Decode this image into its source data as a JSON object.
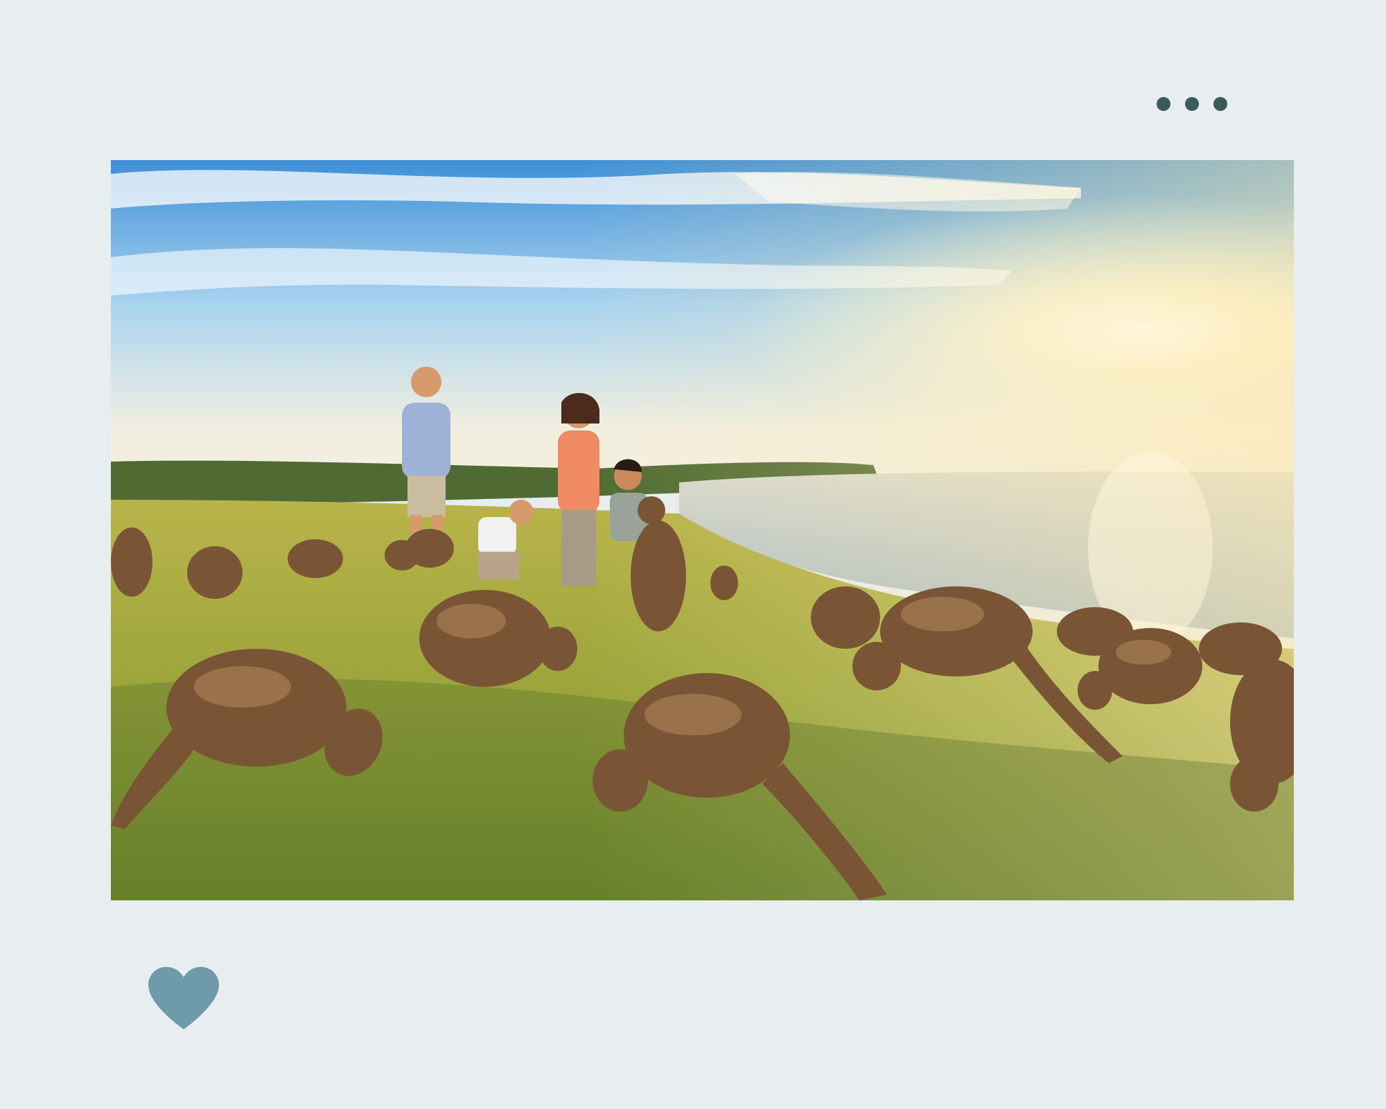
{
  "post": {
    "menu_icon": "more-horizontal-icon",
    "photo_subject": "kangaroos-grazing-on-coastal-clifftop-at-sunset",
    "like_icon": "heart-icon",
    "colors": {
      "background": "#e8edf0",
      "menu_dots": "#3b5b5a",
      "heart": "#6f9aaa"
    }
  }
}
